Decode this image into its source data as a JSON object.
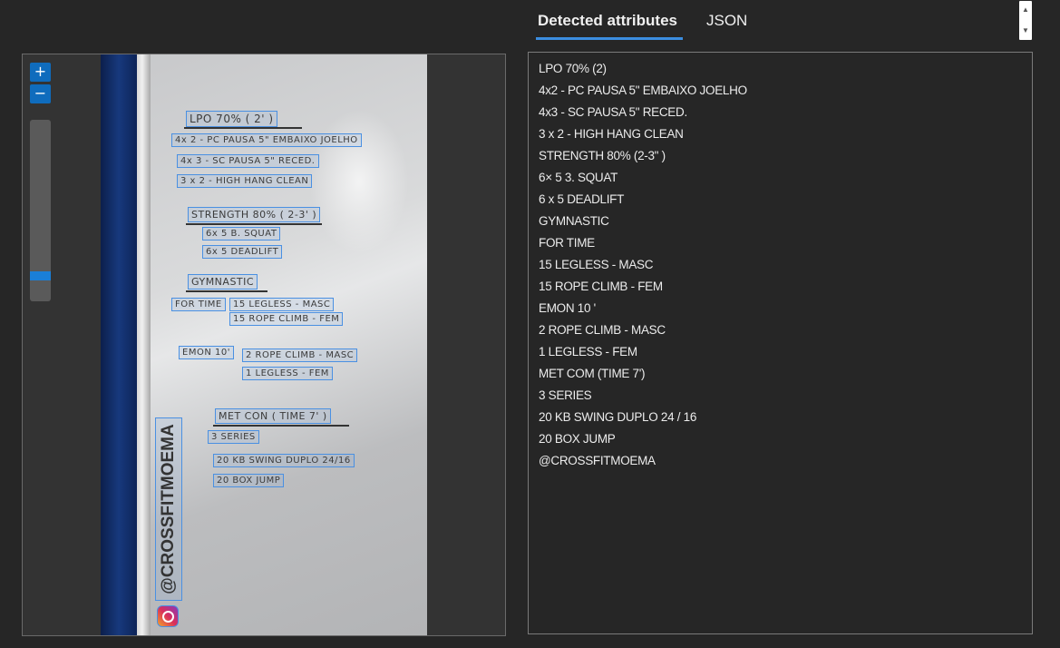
{
  "tabs": [
    {
      "label": "Detected attributes",
      "active": true
    },
    {
      "label": "JSON",
      "active": false
    }
  ],
  "zoom": {
    "in_label": "+",
    "out_label": "−",
    "level": 0.05
  },
  "image": {
    "watermark": "@CROSSFITMOEMA",
    "words": [
      "LPO 70% ( 2' )",
      "4x 2 - PC PAUSA 5\" EMBAIXO JOELHO",
      "4x 3 - SC PAUSA 5\" RECED.",
      "3 x 2 - HIGH HANG CLEAN",
      "STRENGTH 80% ( 2-3' )",
      "6x 5 B. SQUAT",
      "6x 5 DEADLIFT",
      "GYMNASTIC",
      "FOR TIME",
      "15 LEGLESS - MASC",
      "15 ROPE CLIMB - FEM",
      "EMON 10'",
      "2 ROPE CLIMB - MASC",
      "1 LEGLESS - FEM",
      "MET CON ( TIME 7' )",
      "3 SERIES",
      "20 KB SWING DUPLO 24/16",
      "20 BOX JUMP"
    ]
  },
  "attributes": [
    "LPO 70% (2)",
    "4x2 - PC PAUSA 5\" EMBAIXO JOELHO",
    "4x3 - SC PAUSA 5\" RECED.",
    "3 x 2 - HIGH HANG CLEAN",
    "STRENGTH 80% (2-3\" )",
    "6× 5 3. SQUAT",
    "6 x 5 DEADLIFT",
    "GYMNASTIC",
    "FOR TIME",
    "15 LEGLESS - MASC",
    "15 ROPE CLIMB - FEM",
    "EMON 10 '",
    "2 ROPE CLIMB - MASC",
    "1 LEGLESS - FEM",
    "MET COM (TIME 7')",
    "3 SERIES",
    "20 KB SWING DUPLO 24 / 16",
    "20 BOX JUMP",
    "@CROSSFITMOEMA"
  ],
  "colors": {
    "accent": "#3b8de0",
    "box_outline": "#4a90e2",
    "background": "#262626"
  }
}
